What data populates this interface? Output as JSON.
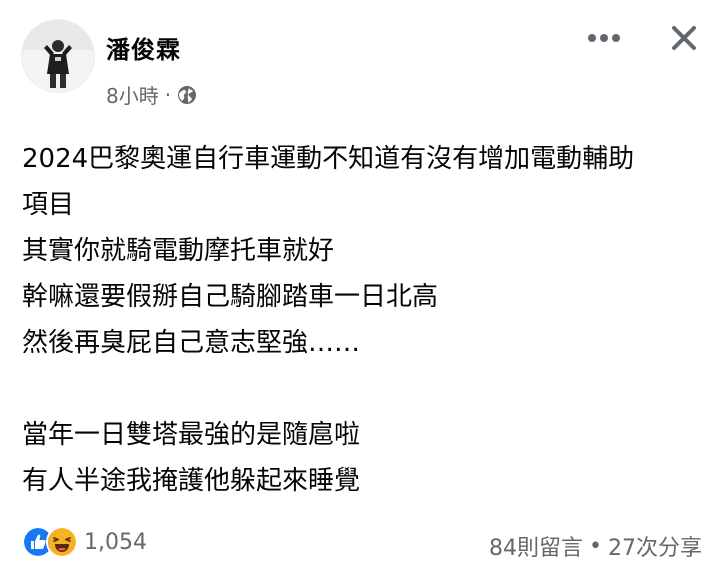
{
  "post": {
    "author": "潘俊霖",
    "time": "8小時",
    "separator": "·",
    "privacy_icon": "globe-icon",
    "lines": [
      "2024巴黎奧運自行車運動不知道有沒有增加電動輔助",
      "項目",
      "其實你就騎電動摩托車就好",
      "幹嘛還要假掰自己騎腳踏車一日北高",
      "然後再臭屁自己意志堅強……",
      "",
      "當年一日雙塔最強的是隨扈啦",
      "有人半途我掩護他躲起來睡覺"
    ]
  },
  "footer": {
    "reaction_icons": [
      "like-icon",
      "haha-icon"
    ],
    "reaction_count": "1,054",
    "comments": "84則留言",
    "dot": "•",
    "shares": "27次分享"
  },
  "colors": {
    "like_blue": "#1877f2",
    "haha_yellow": "#f7b125",
    "secondary_text": "#65676b",
    "primary_text": "#050505"
  }
}
